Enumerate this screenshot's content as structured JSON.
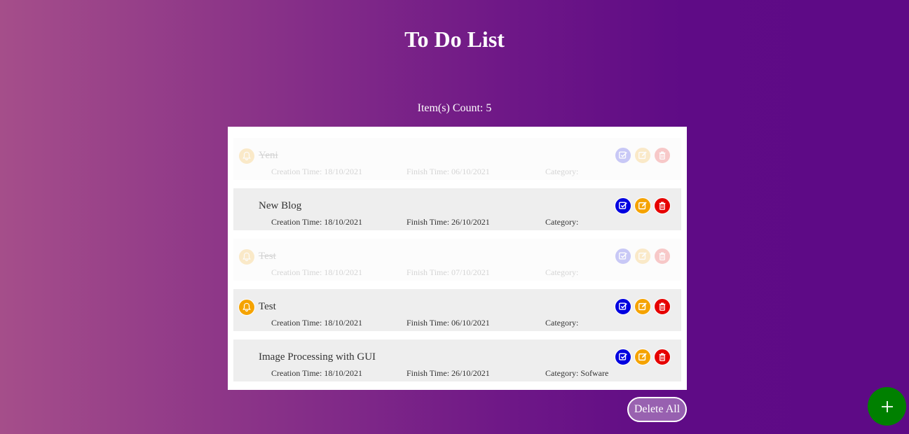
{
  "header": {
    "title": "To Do List",
    "count_label": "Item(s) Count: 5"
  },
  "items": [
    {
      "title": "Yeni",
      "created": "Creation Time: 18/10/2021",
      "finish": "Finish Time: 06/10/2021",
      "category": "Category:",
      "completed": true,
      "reminder": true
    },
    {
      "title": "New Blog",
      "created": "Creation Time: 18/10/2021",
      "finish": "Finish Time: 26/10/2021",
      "category": "Category:",
      "completed": false,
      "reminder": false
    },
    {
      "title": "Test",
      "created": "Creation Time: 18/10/2021",
      "finish": "Finish Time: 07/10/2021",
      "category": "Category:",
      "completed": true,
      "reminder": true
    },
    {
      "title": "Test",
      "created": "Creation Time: 18/10/2021",
      "finish": "Finish Time: 06/10/2021",
      "category": "Category:",
      "completed": false,
      "reminder": true
    },
    {
      "title": "Image Processing with GUI",
      "created": "Creation Time: 18/10/2021",
      "finish": "Finish Time: 26/10/2021",
      "category": "Category: Sofware",
      "completed": false,
      "reminder": false
    }
  ],
  "actions": {
    "delete_all_label": "Delete All"
  },
  "icons": {
    "reminder": "bell-icon",
    "complete": "check-square-icon",
    "edit": "edit-icon",
    "delete": "trash-icon",
    "add": "plus-icon"
  },
  "colors": {
    "complete": "#0000e0",
    "edit": "#f5a300",
    "delete": "#e60000",
    "add": "#008000"
  }
}
